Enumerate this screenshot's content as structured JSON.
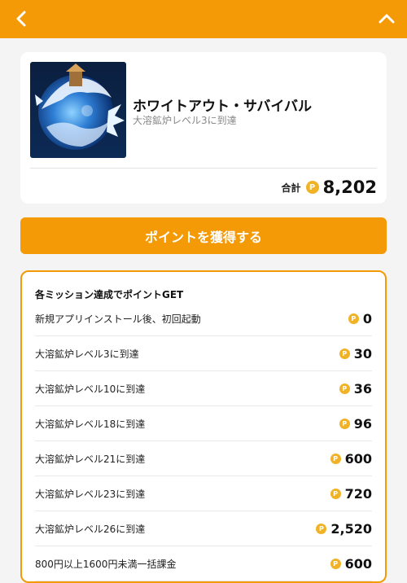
{
  "header": {
    "back_icon": "chevron-left-icon",
    "collapse_icon": "chevron-up-icon",
    "bg_color": "#f39a06"
  },
  "app": {
    "title": "ホワイトアウト・サバイバル",
    "subtitle": "大溶鉱炉レベル3に到達",
    "thumbnail_icon": "snow-globe-game-icon",
    "total_label": "合計",
    "point_symbol": "P",
    "total_points": "8,202"
  },
  "cta": {
    "label": "ポイントを獲得する",
    "color": "#f39a06"
  },
  "missions": {
    "heading": "各ミッション達成でポイントGET",
    "point_symbol": "P",
    "items": [
      {
        "label": "新規アプリインストール後、初回起動",
        "points": "0"
      },
      {
        "label": "大溶鉱炉レベル3に到達",
        "points": "30"
      },
      {
        "label": "大溶鉱炉レベル10に到達",
        "points": "36"
      },
      {
        "label": "大溶鉱炉レベル18に到達",
        "points": "96"
      },
      {
        "label": "大溶鉱炉レベル21に到達",
        "points": "600"
      },
      {
        "label": "大溶鉱炉レベル23に到達",
        "points": "720"
      },
      {
        "label": "大溶鉱炉レベル26に到達",
        "points": "2,520"
      },
      {
        "label": "800円以上1600円未満一括課金",
        "points": "600"
      }
    ]
  }
}
